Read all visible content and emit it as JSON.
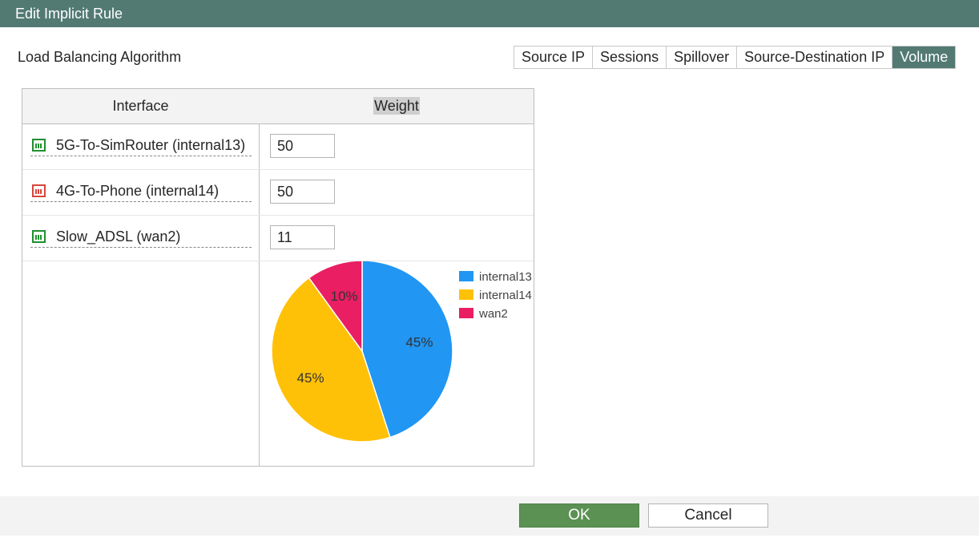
{
  "window": {
    "title": "Edit Implicit Rule"
  },
  "algorithm": {
    "label": "Load Balancing Algorithm",
    "options": [
      "Source IP",
      "Sessions",
      "Spillover",
      "Source-Destination IP",
      "Volume"
    ],
    "selected": "Volume"
  },
  "table": {
    "headers": {
      "interface": "Interface",
      "weight": "Weight"
    },
    "rows": [
      {
        "interface": "5G-To-SimRouter (internal13)",
        "weight": "50",
        "status_color": "#1f8f2f",
        "icon": "port-up-icon"
      },
      {
        "interface": "4G-To-Phone (internal14)",
        "weight": "50",
        "status_color": "#d9453a",
        "icon": "port-down-icon"
      },
      {
        "interface": "Slow_ADSL (wan2)",
        "weight": "11",
        "status_color": "#1f8f2f",
        "icon": "port-up-icon"
      }
    ]
  },
  "chart_data": {
    "type": "pie",
    "categories": [
      "internal13",
      "internal14",
      "wan2"
    ],
    "values": [
      45,
      45,
      10
    ],
    "labels": [
      "45%",
      "45%",
      "10%"
    ],
    "colors": [
      "#2196f3",
      "#ffc107",
      "#e91e63"
    ],
    "legend": "top-right"
  },
  "footer": {
    "ok_label": "OK",
    "cancel_label": "Cancel"
  }
}
